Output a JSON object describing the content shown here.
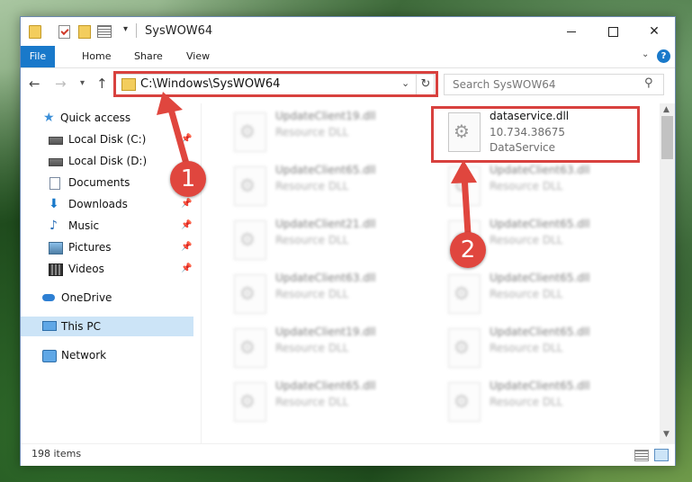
{
  "window": {
    "title": "SysWOW64",
    "qa_dropdown": "▾"
  },
  "ribbon": {
    "tabs": [
      "File",
      "Home",
      "Share",
      "View"
    ],
    "help": "?"
  },
  "nav": {
    "address": "C:\\Windows\\SysWOW64",
    "search_placeholder": "Search SysWOW64"
  },
  "sidebar": {
    "items": [
      {
        "label": "Quick access",
        "icon": "star-icon"
      },
      {
        "label": "Local Disk (C:)",
        "icon": "disk-icon"
      },
      {
        "label": "Local Disk (D:)",
        "icon": "disk-icon"
      },
      {
        "label": "Documents",
        "icon": "document-icon"
      },
      {
        "label": "Downloads",
        "icon": "download-icon"
      },
      {
        "label": "Music",
        "icon": "music-icon"
      },
      {
        "label": "Pictures",
        "icon": "pictures-icon"
      },
      {
        "label": "Videos",
        "icon": "video-icon"
      },
      {
        "label": "OneDrive",
        "icon": "cloud-icon"
      },
      {
        "label": "This PC",
        "icon": "computer-icon"
      },
      {
        "label": "Network",
        "icon": "network-icon"
      }
    ]
  },
  "files": {
    "featured": {
      "name": "dataservice.dll",
      "version": "10.734.38675",
      "description": "DataService"
    },
    "left_column": [
      {
        "name": "UpdateClient19.dll",
        "type": "Resource DLL"
      },
      {
        "name": "UpdateClient65.dll",
        "type": "Resource DLL"
      },
      {
        "name": "UpdateClient21.dll",
        "type": "Resource DLL"
      },
      {
        "name": "UpdateClient63.dll",
        "type": "Resource DLL"
      },
      {
        "name": "UpdateClient19.dll",
        "type": "Resource DLL"
      },
      {
        "name": "UpdateClient65.dll",
        "type": "Resource DLL"
      }
    ],
    "right_column": [
      {
        "name": "UpdateClient63.dll",
        "type": "Resource DLL"
      },
      {
        "name": "UpdateClient65.dll",
        "type": "Resource DLL"
      },
      {
        "name": "UpdateClient65.dll",
        "type": "Resource DLL"
      },
      {
        "name": "UpdateClient65.dll",
        "type": "Resource DLL"
      },
      {
        "name": "UpdateClient65.dll",
        "type": "Resource DLL"
      }
    ]
  },
  "status": {
    "item_count": "198 items"
  },
  "annotations": {
    "badge_1": "1",
    "badge_2": "2",
    "color": "#d8413e"
  }
}
